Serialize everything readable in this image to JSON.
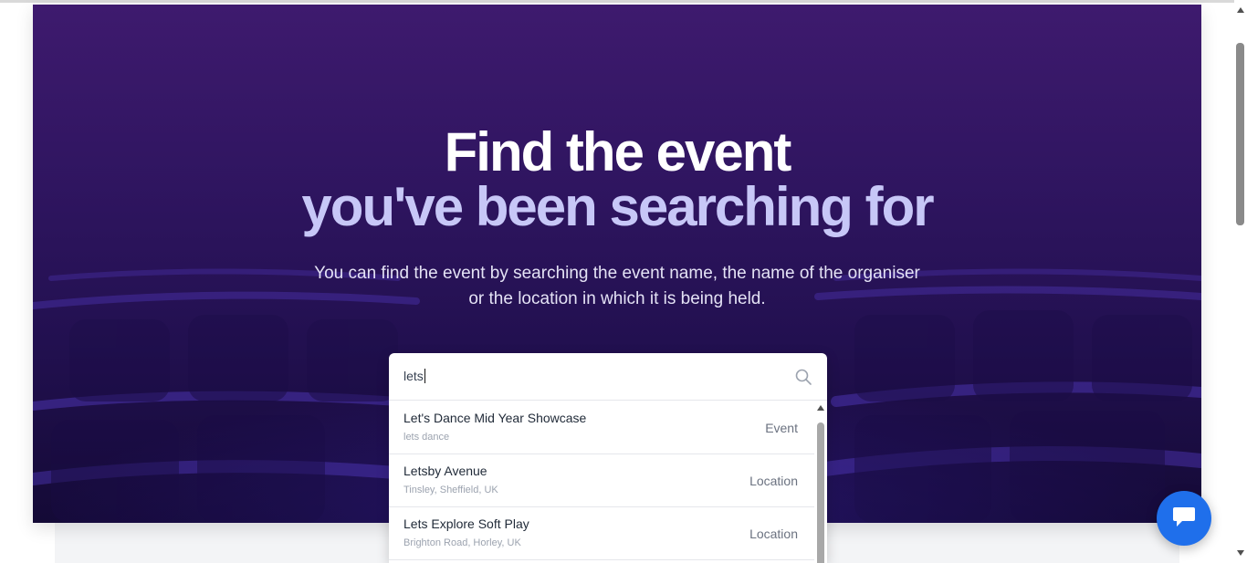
{
  "hero": {
    "title_line1": "Find the event",
    "title_line2": "you've been searching for",
    "subtitle_line1": "You can find the event by searching the event name, the name of the organiser",
    "subtitle_line2": "or the location in which it is being held."
  },
  "search": {
    "value": "lets",
    "icon": "search-icon",
    "results": [
      {
        "name": "Let's Dance Mid Year Showcase",
        "sub": "lets dance",
        "type": "Event"
      },
      {
        "name": "Letsby Avenue",
        "sub": "Tinsley, Sheffield, UK",
        "type": "Location"
      },
      {
        "name": "Lets Explore Soft Play",
        "sub": "Brighton Road, Horley, UK",
        "type": "Location"
      }
    ]
  },
  "chat": {
    "icon": "chat-icon"
  },
  "colors": {
    "hero_top": "#3e1a6e",
    "hero_bottom": "#140a36",
    "title_accent": "#c7c7f7",
    "chat_button": "#1f6feb"
  }
}
